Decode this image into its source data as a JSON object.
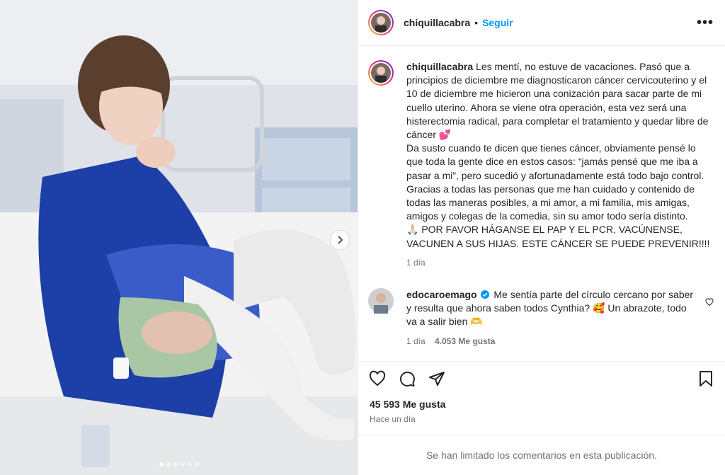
{
  "post": {
    "username": "chiquillacabra",
    "separator": "•",
    "follow_label": "Seguir",
    "more_label": "•••"
  },
  "caption": {
    "username": "chiquillacabra",
    "paragraph1": "Les mentí, no estuve de vacaciones. Pasó que a principios de diciembre me diagnosticaron cáncer cervicouterino y el 10 de diciembre me hicieron una conización para sacar parte de mi cuello uterino. Ahora se viene otra operación, esta vez será una histerectomia radical, para completar el tratamiento y quedar libre de cáncer 💕",
    "paragraph2": "Da susto cuando te dicen que tienes cáncer, obviamente pensé lo que toda la gente dice en estos casos: “jamás pensé que me iba a pasar a mi”, pero sucedió y afortunadamente está todo bajo control. Gracias a todas las personas que me han cuidado y contenido de todas las maneras posibles, a mi amor, a mi familia, mis amigas, amigos y colegas de la comedia, sin su amor todo sería distinto.",
    "paragraph3": "🙏🏻 POR FAVOR HÁGANSE EL PAP Y EL PCR, VACÚNENSE, VACUNEN A SUS HIJAS. ESTE CÁNCER SE PUEDE PREVENIR!!!!",
    "time": "1 día"
  },
  "comment": {
    "username": "edocaroemago",
    "text": "Me sentía parte del círculo cercano por saber y resulta que ahora saben todos Cynthia? 🥰 Un abrazote, todo va a salir bien 🫶",
    "time": "1 día",
    "likes": "4.053 Me gusta"
  },
  "footer": {
    "likes": "45 593 Me gusta",
    "time": "Hace un día",
    "limited": "Se han limitado los comentarios en esta publicación."
  },
  "icons": {
    "like": "heart-icon",
    "comment": "comment-icon",
    "share": "share-icon",
    "save": "bookmark-icon",
    "verified": "verified-icon"
  },
  "colors": {
    "link": "#0095f6",
    "muted": "#737373",
    "verified": "#0095f6"
  },
  "carousel": {
    "count": 6,
    "active": 0
  }
}
